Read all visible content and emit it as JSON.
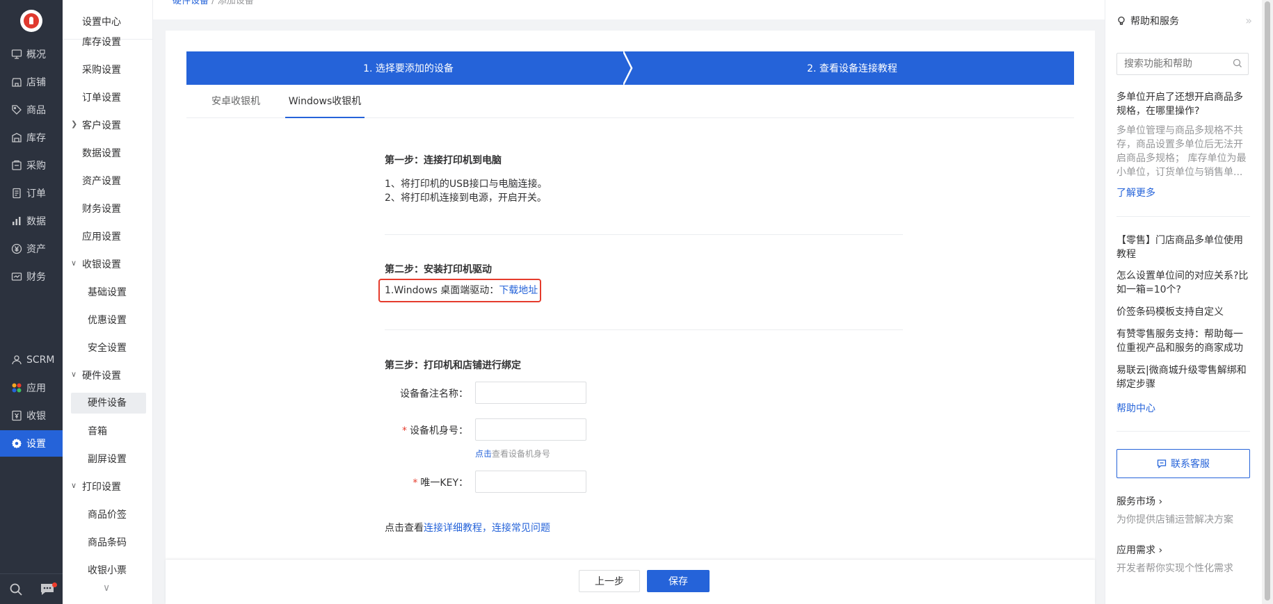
{
  "nav1": {
    "items": [
      {
        "label": "概况",
        "icon": "monitor-icon"
      },
      {
        "label": "店铺",
        "icon": "store-icon"
      },
      {
        "label": "商品",
        "icon": "tag-icon"
      },
      {
        "label": "库存",
        "icon": "warehouse-icon"
      },
      {
        "label": "采购",
        "icon": "purchase-icon"
      },
      {
        "label": "订单",
        "icon": "order-icon"
      },
      {
        "label": "数据",
        "icon": "bar-chart-icon"
      },
      {
        "label": "资产",
        "icon": "yen-icon"
      },
      {
        "label": "财务",
        "icon": "finance-icon"
      },
      {
        "label": "SCRM",
        "icon": "user-icon"
      },
      {
        "label": "应用",
        "icon": "apps-icon"
      },
      {
        "label": "收银",
        "icon": "cashier-icon"
      },
      {
        "label": "设置",
        "icon": "gear-icon"
      }
    ],
    "active": "设置",
    "active_color": "#2563d9"
  },
  "nav2": {
    "title": "设置中心",
    "items": [
      "库存设置",
      "采购设置",
      "订单设置",
      "客户设置",
      "数据设置",
      "资产设置",
      "财务设置",
      "应用设置",
      "收银设置",
      "基础设置",
      "优惠设置",
      "安全设置",
      "硬件设置",
      "硬件设备",
      "音箱",
      "副屏设置",
      "打印设置",
      "商品价签",
      "商品条码",
      "收银小票"
    ],
    "selected": "硬件设备"
  },
  "breadcrumb": {
    "parent": "硬件设备",
    "sep": "/",
    "current": "添加设备"
  },
  "steps": {
    "step1": "1. 选择要添加的设备",
    "step2": "2. 查看设备连接教程"
  },
  "tabs": {
    "android": "安卓收银机",
    "windows": "Windows收银机",
    "active": "Windows收银机"
  },
  "step_one": {
    "title": "第一步：连接打印机到电脑",
    "line1": "1、将打印机的USB接口与电脑连接。",
    "line2": "2、将打印机连接到电源，开启开关。"
  },
  "step_two": {
    "title": "第二步：安装打印机驱动",
    "line1": "1.Windows 桌面端驱动：",
    "link": "下载地址"
  },
  "step_three": {
    "title": "第三步：打印机和店铺进行绑定",
    "field_name": "设备备注名称：",
    "field_id": "设备机身号：",
    "hint_link": "点击",
    "hint_text": "查看设备机身号",
    "field_key": "唯一KEY：",
    "name_value": "",
    "id_value": "",
    "key_value": ""
  },
  "tutorial": {
    "prefix": "点击查看",
    "link1": "连接详细教程",
    "comma": "，",
    "link2": "连接常见问题"
  },
  "footer": {
    "prev": "上一步",
    "save": "保存"
  },
  "help": {
    "title": "帮助和服务",
    "search_placeholder": "搜索功能和帮助",
    "q1": "多单位开启了还想开启商品多规格，在哪里操作?",
    "q1_desc": "多单位管理与商品多规格不共存，商品设置多单位后无法开启商品多规格； 库存单位为最小单位，订货单位与销售单...",
    "learn_more": "了解更多",
    "articles": [
      "【零售】门店商品多单位使用教程",
      "怎么设置单位间的对应关系?比如一箱=10个?",
      "价签条码模板支持自定义",
      "有赞零售服务支持：帮助每一位重视产品和服务的商家成功",
      "易联云|微商城升级零售解绑和绑定步骤"
    ],
    "help_center": "帮助中心",
    "contact": "联系客服",
    "market_title": "服务市场",
    "market_desc": "为你提供店铺运营解决方案",
    "demand_title": "应用需求",
    "demand_desc": "开发者帮你实现个性化需求"
  }
}
